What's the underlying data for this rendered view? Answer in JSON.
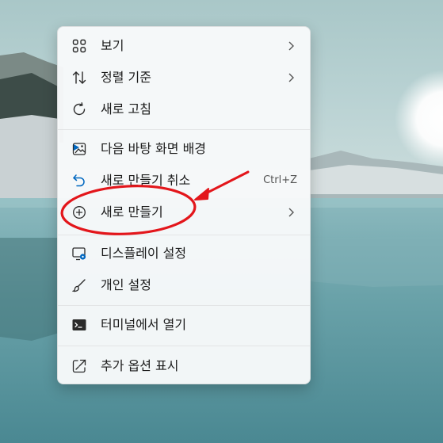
{
  "menu": {
    "items": [
      {
        "label": "보기",
        "icon": "grid-icon"
      },
      {
        "label": "정렬 기준",
        "icon": "sort-icon"
      },
      {
        "label": "새로 고침",
        "icon": "refresh-icon"
      },
      {
        "label": "다음 바탕 화면 배경",
        "icon": "next-background-icon"
      },
      {
        "label": "새로 만들기 취소",
        "icon": "undo-icon",
        "shortcut": "Ctrl+Z"
      },
      {
        "label": "새로 만들기",
        "icon": "plus-circle-icon"
      },
      {
        "label": "디스플레이 설정",
        "icon": "display-settings-icon"
      },
      {
        "label": "개인 설정",
        "icon": "brush-icon"
      },
      {
        "label": "터미널에서 열기",
        "icon": "terminal-icon"
      },
      {
        "label": "추가 옵션 표시",
        "icon": "more-options-icon"
      }
    ]
  },
  "annotation": {
    "color": "#e3161b"
  },
  "colors": {
    "icon": "#2b2b2b",
    "accent": "#0067c0"
  }
}
